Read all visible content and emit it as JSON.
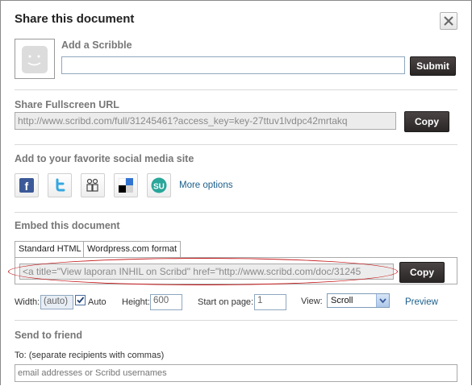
{
  "dialog": {
    "title": "Share this document"
  },
  "scribble": {
    "label": "Add a Scribble",
    "input_value": "",
    "submit_label": "Submit"
  },
  "fullscreen": {
    "label": "Share Fullscreen URL",
    "url": "http://www.scribd.com/full/31245461?access_key=key-27ttuv1lvdpc42mrtakq",
    "copy_label": "Copy"
  },
  "social": {
    "label": "Add to your favorite social media site",
    "icons": [
      "facebook-icon",
      "twitter-icon",
      "myspace-icon",
      "delicious-icon",
      "stumbleupon-icon"
    ],
    "more_label": "More options"
  },
  "embed": {
    "label": "Embed this document",
    "tabs": [
      "Standard HTML",
      "Wordpress.com format"
    ],
    "code": "<a title=\"View laporan INHIL on Scribd\" href=\"http://www.scribd.com/doc/31245",
    "copy_label": "Copy",
    "width_label": "Width:",
    "width_value": "(auto)",
    "auto_label": "Auto",
    "auto_checked": true,
    "height_label": "Height:",
    "height_value": "600",
    "start_page_label": "Start on page:",
    "start_page_value": "1",
    "view_label": "View:",
    "view_value": "Scroll",
    "preview_label": "Preview"
  },
  "friend": {
    "label": "Send to friend",
    "to_label": "To: (separate recipients with commas)",
    "placeholder": "email addresses or Scribd usernames"
  },
  "colors": {
    "dark_button": "#2b2626",
    "link": "#1a5e8a",
    "highlight": "#c4181a"
  }
}
